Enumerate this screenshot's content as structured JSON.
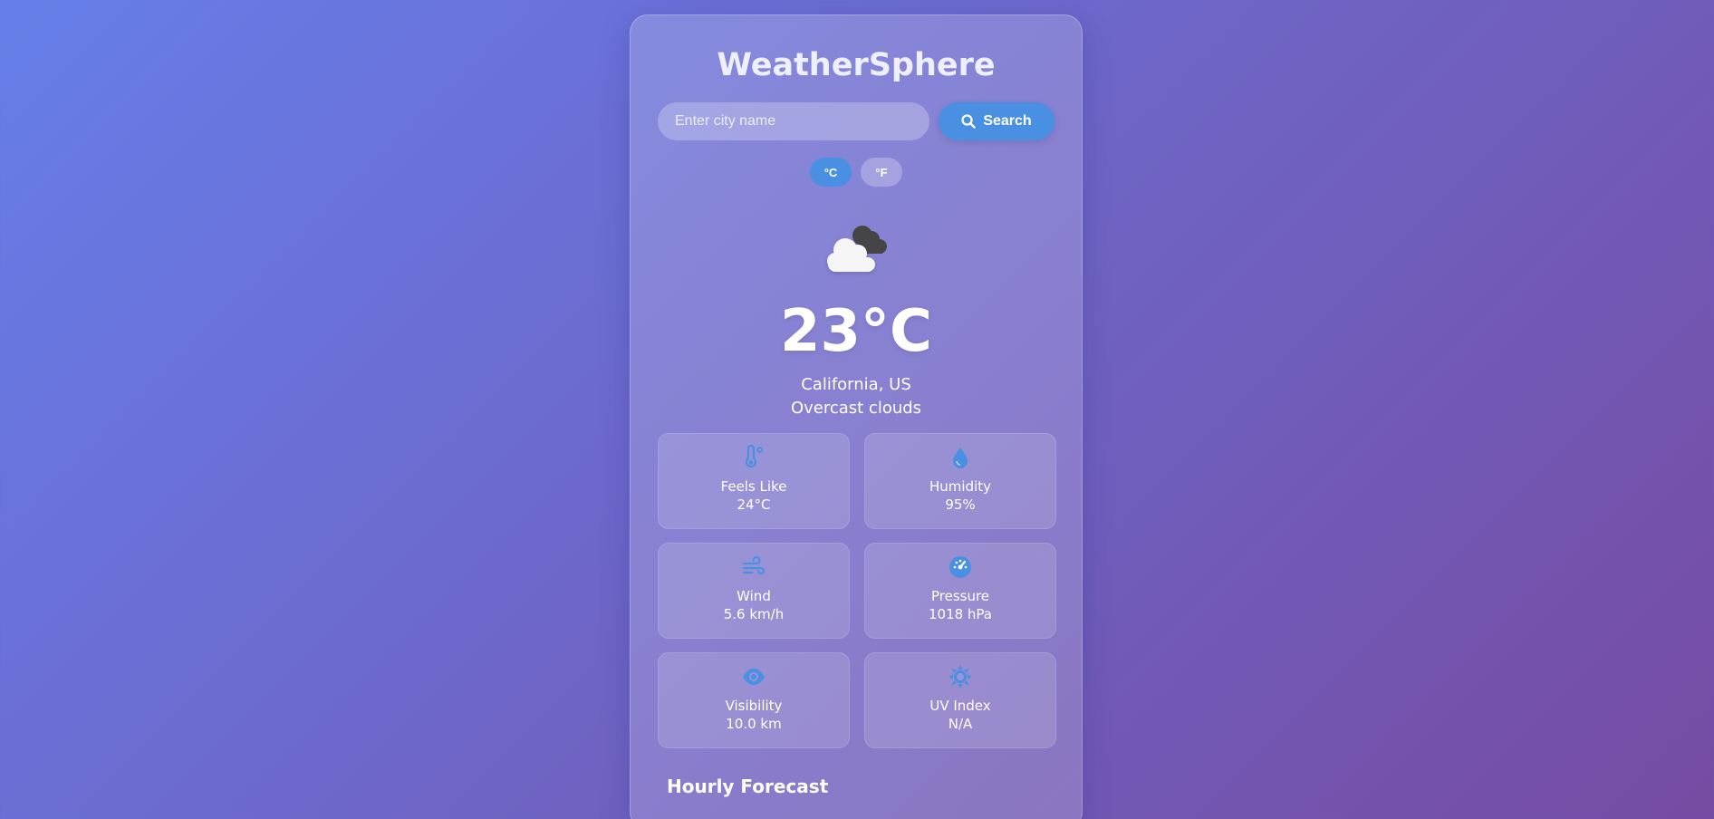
{
  "app": {
    "title": "WeatherSphere"
  },
  "search": {
    "placeholder": "Enter city name",
    "value": "",
    "button_label": "Search"
  },
  "units": {
    "celsius_label": "°C",
    "fahrenheit_label": "°F",
    "selected": "°C"
  },
  "current": {
    "icon": "overcast-clouds-icon",
    "temperature": "23°C",
    "location": "California, US",
    "description": "Overcast clouds"
  },
  "details": [
    {
      "icon": "thermometer-icon",
      "label": "Feels Like",
      "value": "24°C"
    },
    {
      "icon": "water-drop-icon",
      "label": "Humidity",
      "value": "95%"
    },
    {
      "icon": "wind-icon",
      "label": "Wind",
      "value": "5.6 km/h"
    },
    {
      "icon": "gauge-icon",
      "label": "Pressure",
      "value": "1018 hPa"
    },
    {
      "icon": "eye-icon",
      "label": "Visibility",
      "value": "10.0 km"
    },
    {
      "icon": "sun-icon",
      "label": "UV Index",
      "value": "N/A"
    }
  ],
  "hourly": {
    "title": "Hourly Forecast"
  },
  "colors": {
    "accent": "#4a90e2",
    "background_start": "#667eea",
    "background_end": "#764ba2"
  }
}
